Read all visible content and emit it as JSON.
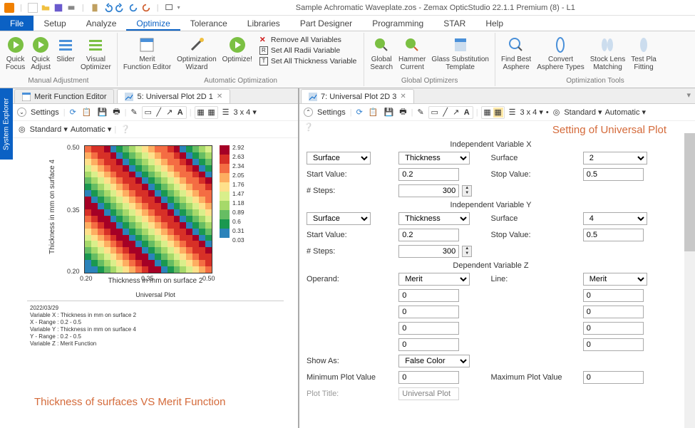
{
  "titlebar": {
    "app_title": "Sample Achromatic Waveplate.zos - Zemax OpticStudio 22.1.1   Premium (8) - L1"
  },
  "menubar": {
    "file": "File",
    "items": [
      "Setup",
      "Analyze",
      "Optimize",
      "Tolerance",
      "Libraries",
      "Part Designer",
      "Programming",
      "STAR",
      "Help"
    ]
  },
  "ribbon": {
    "groups": {
      "manual": {
        "label": "Manual Adjustment",
        "buttons": [
          "Quick\nFocus",
          "Quick\nAdjust",
          "Slider",
          "Visual\nOptimizer"
        ]
      },
      "auto": {
        "label": "Automatic Optimization",
        "buttons": [
          "Merit\nFunction Editor",
          "Optimization\nWizard",
          "Optimize!"
        ],
        "vlist": [
          "Remove All Variables",
          "Set All Radii Variable",
          "Set All Thickness Variable"
        ]
      },
      "global": {
        "label": "Global Optimizers",
        "buttons": [
          "Global\nSearch",
          "Hammer\nCurrent",
          "Glass Substitution\nTemplate"
        ]
      },
      "tools": {
        "label": "Optimization Tools",
        "buttons": [
          "Find Best\nAsphere",
          "Convert\nAsphere Types",
          "Stock Lens\nMatching",
          "Test Pla\nFitting"
        ]
      }
    }
  },
  "side_strip": "System Explorer",
  "left_pane": {
    "tabs": {
      "t0": "Merit Function Editor",
      "t1": "5: Universal Plot 2D 1"
    },
    "toolbar": {
      "settings": "Settings",
      "grid": "3 x 4",
      "std": "Standard",
      "auto": "Automatic"
    },
    "chart": {
      "title": "Universal Plot",
      "xlabel": "Thickness in mm on surface 2",
      "ylabel": "Thickness in mm on surface 4",
      "xticks": [
        "0.20",
        "0.35",
        "0.50"
      ],
      "yticks": [
        "0.20",
        "0.35",
        "0.50"
      ]
    },
    "meta": {
      "date": "2022/03/29",
      "l1": "Variable X : Thickness in mm on surface 2",
      "l2": "X - Range : 0.2 - 0.5",
      "l3": "Variable Y : Thickness in mm on surface 4",
      "l4": "Y - Range : 0.2 - 0.5",
      "l5": "Variable Z : Merit Function"
    },
    "annotation": "Thickness of surfaces VS Merit Function"
  },
  "right_pane": {
    "tab": "7: Universal Plot 2D 3",
    "toolbar": {
      "settings": "Settings",
      "grid": "3 x 4",
      "std": "Standard",
      "auto": "Automatic"
    },
    "annotation": "Setting of Universal Plot",
    "form": {
      "sec_x": "Independent Variable X",
      "sec_y": "Independent Variable Y",
      "sec_z": "Dependent Variable Z",
      "x": {
        "cat": "Surface",
        "param": "Thickness",
        "surf_label": "Surface",
        "surf_val": "2",
        "start_label": "Start Value:",
        "start_val": "0.2",
        "stop_label": "Stop Value:",
        "stop_val": "0.5",
        "steps_label": "# Steps:",
        "steps_val": "300"
      },
      "y": {
        "cat": "Surface",
        "param": "Thickness",
        "surf_label": "Surface",
        "surf_val": "4",
        "start_label": "Start Value:",
        "start_val": "0.2",
        "stop_label": "Stop Value:",
        "stop_val": "0.5",
        "steps_label": "# Steps:",
        "steps_val": "300"
      },
      "z": {
        "operand_label": "Operand:",
        "operand_val": "Merit",
        "line_label": "Line:",
        "line_val": "Merit",
        "v1": "0",
        "v2": "0",
        "v3": "0",
        "v4": "0",
        "w1": "0",
        "w2": "0",
        "w3": "0",
        "w4": "0"
      },
      "showas_label": "Show As:",
      "showas_val": "False Color",
      "minpv_label": "Minimum Plot Value",
      "minpv_val": "0",
      "maxpv_label": "Maximum Plot Value",
      "maxpv_val": "0",
      "plottitle_label": "Plot Title:",
      "plottitle_val": "Universal Plot"
    }
  },
  "chart_data": {
    "type": "heatmap",
    "title": "Universal Plot",
    "xlabel": "Thickness in mm on surface 2",
    "ylabel": "Thickness in mm on surface 4",
    "xlim": [
      0.2,
      0.5
    ],
    "ylim": [
      0.2,
      0.5
    ],
    "zlabel": "Merit Function",
    "colorbar_ticks": [
      2.92,
      2.63,
      2.34,
      2.05,
      1.76,
      1.47,
      1.18,
      0.89,
      0.6,
      0.31,
      0.03
    ],
    "note": "Diagonal interference-like bands; values oscillate ~0.03–2.92 along x+y",
    "series": []
  }
}
